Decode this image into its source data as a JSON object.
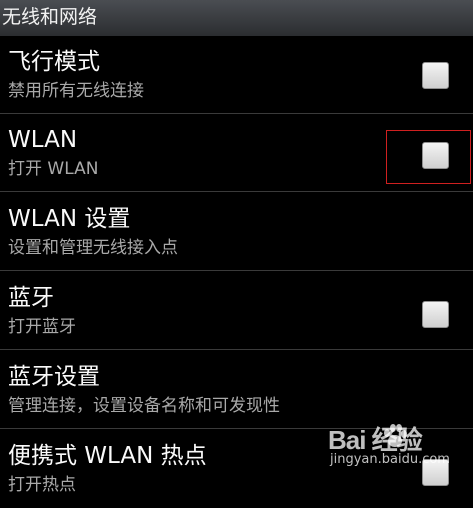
{
  "header": {
    "title": "无线和网络"
  },
  "settings": [
    {
      "title": "飞行模式",
      "summary": "禁用所有无线连接",
      "has_checkbox": true,
      "checked": false
    },
    {
      "title": "WLAN",
      "summary": "打开 WLAN",
      "has_checkbox": true,
      "checked": false
    },
    {
      "title": "WLAN 设置",
      "summary": "设置和管理无线接入点",
      "has_checkbox": false
    },
    {
      "title": "蓝牙",
      "summary": "打开蓝牙",
      "has_checkbox": true,
      "checked": false
    },
    {
      "title": "蓝牙设置",
      "summary": "管理连接，设置设备名称和可发现性",
      "has_checkbox": false
    },
    {
      "title": "便携式 WLAN 热点",
      "summary": "打开热点",
      "has_checkbox": true,
      "checked": false
    }
  ],
  "watermark": {
    "brand": "Bai  经验",
    "url": "jingyan.baidu.com"
  },
  "colors": {
    "highlight": "#d02020",
    "background": "#000000"
  }
}
